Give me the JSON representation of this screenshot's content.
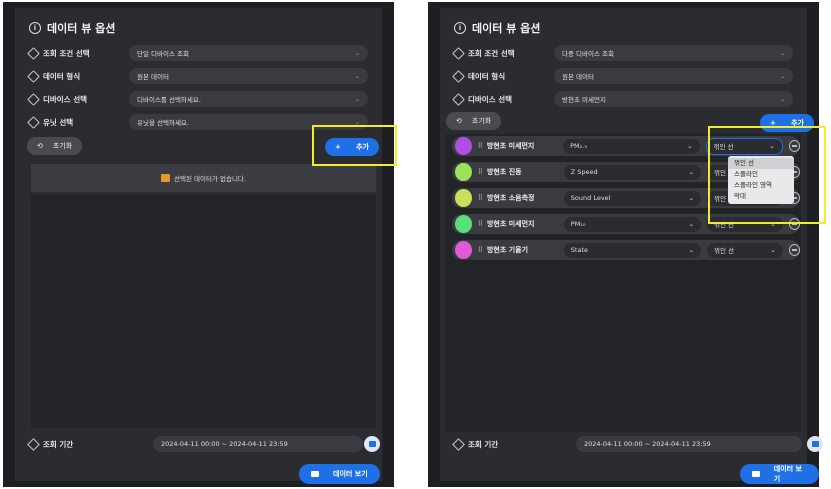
{
  "left": {
    "title": "데이터 뷰 옵션",
    "filters": [
      {
        "label": "조회 조건 선택",
        "value": "단일 디바이스 조회"
      },
      {
        "label": "데이터 형식",
        "value": "원본 데이터"
      },
      {
        "label": "디바이스 선택",
        "value": "디바이스를 선택하세요."
      },
      {
        "label": "유닛 선택",
        "value": "유닛을 선택하세요."
      }
    ],
    "reset_label": "초기화",
    "add_label": "추가",
    "add_plus": "+",
    "empty_message": "선택된 데이터가 없습니다.",
    "period_label": "조회 기간",
    "period_value": "2024-04-11 00:00 ~ 2024-04-11 23:59",
    "view_label": "데이터 보기"
  },
  "right": {
    "title": "데이터 뷰 옵션",
    "filters": [
      {
        "label": "조회 조건 선택",
        "value": "다중 디바이스 조회"
      },
      {
        "label": "데이터 형식",
        "value": "원본 데이터"
      },
      {
        "label": "디바이스 선택",
        "value": "방현초 미세먼지"
      }
    ],
    "reset_label": "초기화",
    "add_label": "추가",
    "add_plus": "+",
    "series": [
      {
        "name": "방현초 미세먼지",
        "field": "PM₂.₅",
        "style": "꺾인 선",
        "color": "#b04ee0"
      },
      {
        "name": "방현초 진동",
        "field": "Z Speed",
        "style": "꺾인 선",
        "color": "#9ee05a"
      },
      {
        "name": "방현초 소음측정",
        "field": "Sound Level",
        "style": "꺾인 선",
        "color": "#c8e05a"
      },
      {
        "name": "방현초 미세먼지",
        "field": "PM₁₀",
        "style": "꺾인 선",
        "color": "#5ae07a"
      },
      {
        "name": "방현초 기울기",
        "field": "State",
        "style": "꺾인 선",
        "color": "#e05ad8"
      }
    ],
    "style_options": [
      "꺾인 선",
      "스플라인",
      "스플라인 영역",
      "막대"
    ],
    "period_label": "조회 기간",
    "period_value": "2024-04-11 00:00 ~ 2024-04-11 23:59",
    "view_label": "데이터 보기"
  },
  "colors": {
    "accent": "#1f6fe6",
    "highlight": "#f3ec2a"
  }
}
